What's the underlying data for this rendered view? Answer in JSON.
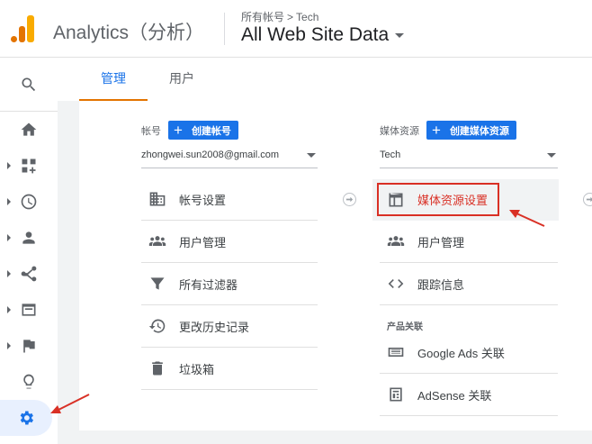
{
  "header": {
    "app_title": "Analytics（分析）",
    "breadcrumb_account": "所有帐号",
    "breadcrumb_sep": ">",
    "breadcrumb_property": "Tech",
    "view_title": "All Web Site Data"
  },
  "rail": {
    "items": [
      {
        "icon": "search-icon"
      },
      {
        "icon": "home-icon"
      },
      {
        "icon": "customization-icon"
      },
      {
        "icon": "realtime-clock-icon"
      },
      {
        "icon": "audience-person-icon"
      },
      {
        "icon": "acquisition-icon"
      },
      {
        "icon": "behavior-icon"
      },
      {
        "icon": "conversions-flag-icon"
      },
      {
        "icon": "discover-lightbulb-icon"
      },
      {
        "icon": "admin-gear-icon"
      }
    ]
  },
  "tabs": {
    "admin": "管理",
    "users": "用户"
  },
  "account_column": {
    "label": "帐号",
    "create_button": "创建帐号",
    "selected_account": "zhongwei.sun2008@gmail.com",
    "items": {
      "settings": "帐号设置",
      "user_management": "用户管理",
      "all_filters": "所有过滤器",
      "change_history": "更改历史记录",
      "trash": "垃圾箱"
    }
  },
  "property_column": {
    "label": "媒体资源",
    "create_button": "创建媒体资源",
    "selected_property": "Tech",
    "items": {
      "property_settings": "媒体资源设置",
      "user_management": "用户管理",
      "tracking_info": "跟踪信息"
    },
    "product_linking_label": "产品关联",
    "links": {
      "google_ads": "Google Ads 关联",
      "adsense": "AdSense 关联"
    }
  },
  "colors": {
    "accent_blue": "#1a73e8",
    "annotation_red": "#d93025",
    "logo_orange": "#f9ab00"
  }
}
